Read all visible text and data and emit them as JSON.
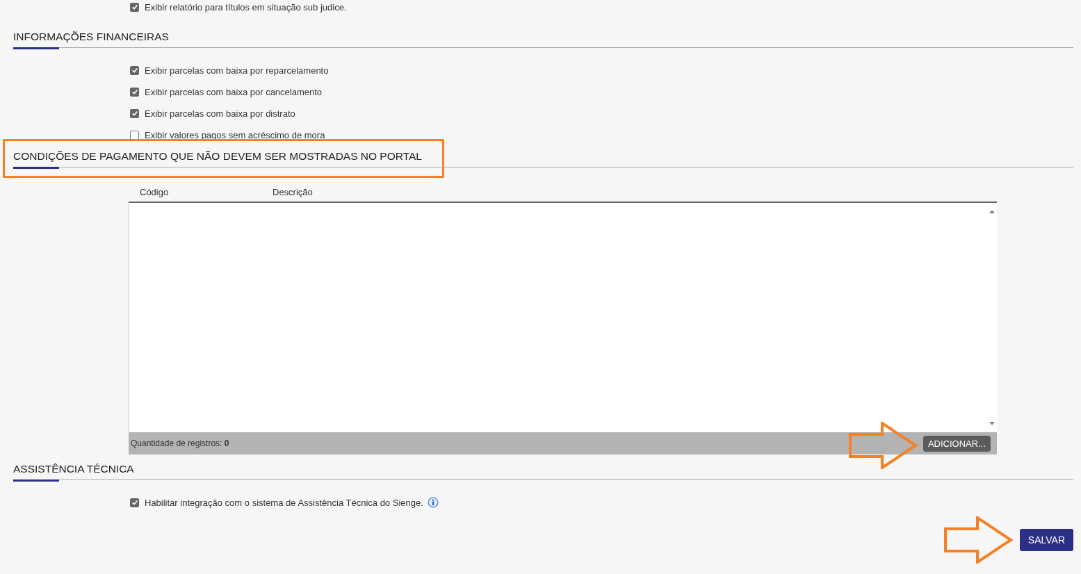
{
  "top_option": {
    "label": "Exibir relatório para títulos em situação sub judice.",
    "checked": true
  },
  "sections": [
    {
      "title": "INFORMAÇÕES FINANCEIRAS",
      "highlighted": false,
      "kind": "options",
      "options": [
        {
          "label": "Exibir parcelas com baixa por reparcelamento",
          "checked": true
        },
        {
          "label": "Exibir parcelas com baixa por cancelamento",
          "checked": true
        },
        {
          "label": "Exibir parcelas com baixa por distrato",
          "checked": true
        },
        {
          "label": "Exibir valores pagos sem acréscimo de mora",
          "checked": false
        }
      ]
    },
    {
      "title": "CONDIÇÕES DE PAGAMENTO QUE NÃO DEVEM SER MOSTRADAS NO PORTAL",
      "highlighted": true,
      "kind": "table",
      "table": {
        "columns": [
          "Código",
          "Descrição"
        ],
        "footer_label": "Quantidade de registros:",
        "footer_count": "0",
        "add_button": {
          "label": "ADICIONAR...",
          "arrow_pointer": true
        }
      }
    },
    {
      "title": "ASSISTÊNCIA TÉCNICA",
      "highlighted": false,
      "kind": "options",
      "options": [
        {
          "label": "Habilitar integração com o sistema de Assistência Técnica do Sienge.",
          "checked": true,
          "info": true
        }
      ]
    }
  ],
  "save_button": {
    "label": "SALVAR",
    "arrow_pointer": true
  }
}
